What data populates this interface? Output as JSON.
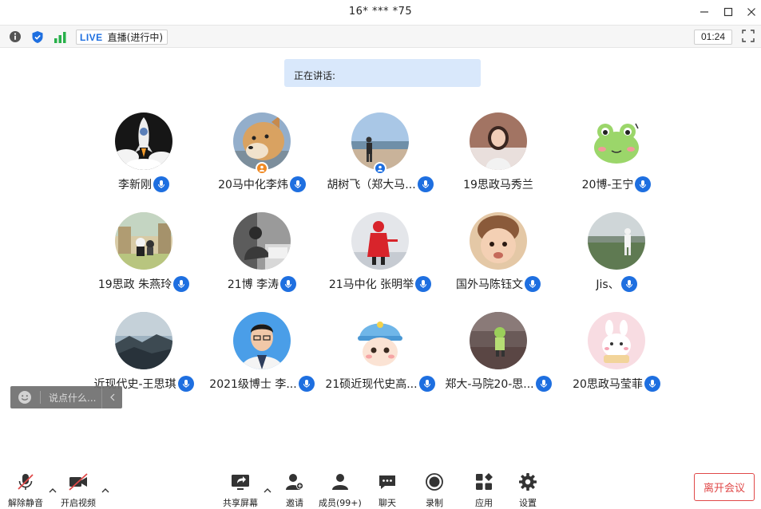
{
  "window": {
    "title": "16* *** *75"
  },
  "status": {
    "live_label": "LIVE",
    "live_status": "直播(进行中)",
    "timer": "01:24"
  },
  "speaking": {
    "label": "正在讲话:"
  },
  "participants": [
    {
      "name": "李新刚"
    },
    {
      "name": "20马中化李炜"
    },
    {
      "name": "胡树飞（郑大马..."
    },
    {
      "name": "19思政马秀兰"
    },
    {
      "name": "20博-王宁"
    },
    {
      "name": "19思政 朱燕玲"
    },
    {
      "name": "21博  李涛"
    },
    {
      "name": "21马中化 张明举"
    },
    {
      "name": "国外马陈钰文"
    },
    {
      "name": "Jis、"
    },
    {
      "name": "近现代史-王思琪"
    },
    {
      "name": "2021级博士  李..."
    },
    {
      "name": "21硕近现代史高..."
    },
    {
      "name": "郑大-马院20-思..."
    },
    {
      "name": "20思政马莹菲"
    }
  ],
  "chat": {
    "placeholder": "说点什么..."
  },
  "toolbar": {
    "unmute": "解除静音",
    "start_video": "开启视频",
    "share_screen": "共享屏幕",
    "invite": "邀请",
    "members": "成员(99+)",
    "chat": "聊天",
    "record": "录制",
    "apps": "应用",
    "settings": "设置",
    "leave": "离开会议"
  },
  "colors": {
    "accent": "#1e6fe0",
    "leave": "#e04848",
    "speaking_bg": "#d9e8fb",
    "host_badge": "#f08a24"
  }
}
